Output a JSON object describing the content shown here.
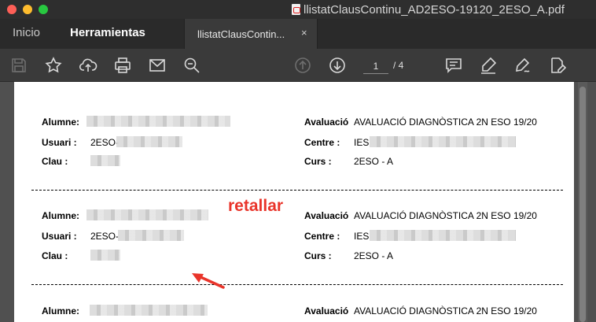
{
  "window": {
    "title": "llistatClausContinu_AD2ESO-19120_2ESO_A.pdf"
  },
  "tabs": {
    "inicio": "Inicio",
    "herramientas": "Herramientas",
    "document_tab": "llistatClausContin...",
    "close_glyph": "×"
  },
  "toolbar": {
    "current_page": "1",
    "page_total": "/  4",
    "icons": [
      "save-icon",
      "bookmark-star-icon",
      "cloud-upload-icon",
      "print-icon",
      "mail-icon",
      "zoom-icon",
      "page-up-icon",
      "page-down-icon",
      "comment-icon",
      "highlight-pen-icon",
      "sign-icon",
      "edit-doc-icon"
    ]
  },
  "records": [
    {
      "alumne_label": "Alumne:",
      "usuari_label": "Usuari :",
      "usuari_value": "2ESO-",
      "clau_label": "Clau :",
      "avaluacio_label": "Avaluació",
      "avaluacio_value": "AVALUACIÓ DIAGNÒSTICA 2N ESO 19/20",
      "centre_label": "Centre :",
      "centre_value": "IES",
      "curs_label": "Curs :",
      "curs_value": "2ESO - A"
    },
    {
      "alumne_label": "Alumne:",
      "usuari_label": "Usuari :",
      "usuari_value": "2ESO-",
      "clau_label": "Clau :",
      "avaluacio_label": "Avaluació",
      "avaluacio_value": "AVALUACIÓ DIAGNÒSTICA 2N ESO 19/20",
      "centre_label": "Centre :",
      "centre_value": "IES",
      "curs_label": "Curs :",
      "curs_value": "2ESO - A"
    },
    {
      "alumne_label": "Alumne:",
      "avaluacio_label": "Avaluació",
      "avaluacio_value": "AVALUACIÓ DIAGNÒSTICA 2N ESO 19/20"
    }
  ],
  "annotation": {
    "text": "retallar",
    "color": "#e9342a"
  }
}
